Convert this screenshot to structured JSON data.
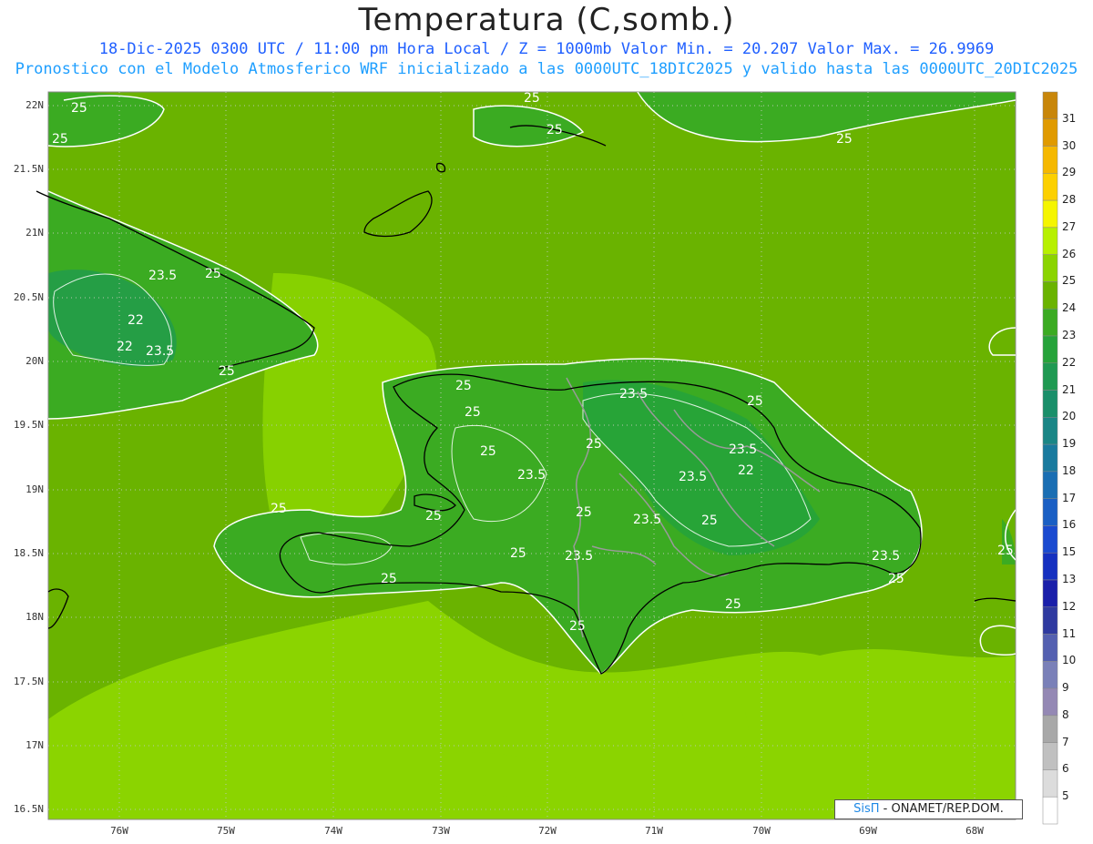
{
  "header": {
    "title": "Temperatura (C,somb.)",
    "subtitle_line1": "18-Dic-2025 0300 UTC / 11:00 pm Hora Local / Z = 1000mb   Valor Min. = 20.207  Valor Max. = 26.9969",
    "subtitle_line2": "Pronostico con el Modelo Atmosferico WRF inicializado a las 0000UTC_18DIC2025 y valido hasta las  0000UTC_20DIC2025"
  },
  "axes": {
    "lat_labels": [
      "22N",
      "21.5N",
      "21N",
      "20.5N",
      "20N",
      "19.5N",
      "19N",
      "18.5N",
      "18N",
      "17.5N",
      "17N",
      "16.5N"
    ],
    "lon_labels": [
      "76W",
      "75W",
      "74W",
      "73W",
      "72W",
      "71W",
      "70W",
      "69W",
      "68W"
    ]
  },
  "contour_labels": [
    "25",
    "23.5",
    "22"
  ],
  "colorbar": {
    "levels": [
      "31",
      "30",
      "29",
      "28",
      "27",
      "26",
      "25",
      "24",
      "23",
      "22",
      "21",
      "20",
      "19",
      "18",
      "17",
      "16",
      "15",
      "13",
      "12",
      "11",
      "10",
      "9",
      "8",
      "7",
      "6",
      "5"
    ],
    "colors": [
      "#c8860a",
      "#e09a00",
      "#f5b800",
      "#fcd000",
      "#f5f500",
      "#b7f000",
      "#8bd400",
      "#6ab300",
      "#3bab22",
      "#26a33a",
      "#1f9952",
      "#1a8f6a",
      "#1a8686",
      "#197a9e",
      "#1a6eb3",
      "#1a5fc4",
      "#1a4ad0",
      "#1530c0",
      "#1a1faa",
      "#2f3aa0",
      "#5460b0",
      "#7a80b8",
      "#9488b4",
      "#a8a8a8",
      "#c0c0c0",
      "#dcdcdc",
      "#ffffff"
    ]
  },
  "credit": {
    "brand": "SisΠ",
    "text": "- ONAMET/REP.DOM."
  }
}
